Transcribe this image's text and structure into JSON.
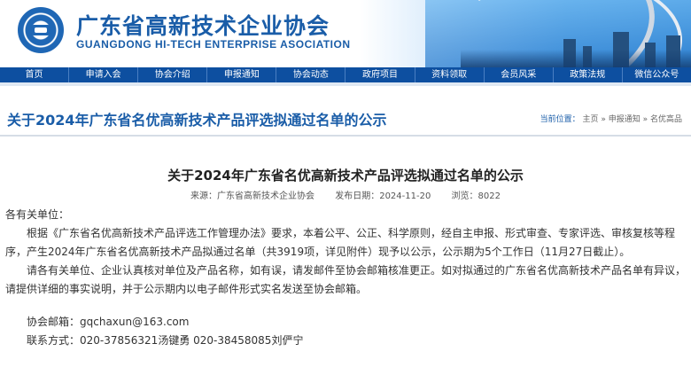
{
  "header": {
    "title": "广东省高新技术企业协会",
    "subtitle": "GUANGDONG HI-TECH ENTERPRISE ASOCIATION"
  },
  "nav": {
    "items": [
      "首页",
      "申请入会",
      "协会介绍",
      "申报通知",
      "协会动态",
      "政府项目",
      "资料领取",
      "会员风采",
      "政策法规",
      "微信公众号"
    ]
  },
  "page": {
    "heading": "关于2024年广东省名优高新技术产品评选拟通过名单的公示",
    "breadcrumb_label": "当前位置：",
    "breadcrumb": [
      "主页",
      "申报通知",
      "名优高品"
    ],
    "breadcrumb_sep": " » "
  },
  "article": {
    "title": "关于2024年广东省名优高新技术产品评选拟通过名单的公示",
    "source": "来源：广东省高新技术企业协会",
    "date": "发布日期：2024-11-20",
    "views": "浏览：8022",
    "greeting": "各有关单位：",
    "para1": "根据《广东省名优高新技术产品评选工作管理办法》要求，本着公平、公正、科学原则，经自主申报、形式审查、专家评选、审核复核等程序，产生2024年广东省名优高新技术产品拟通过名单（共3919项，详见附件）现予以公示，公示期为5个工作日（11月27日截止）。",
    "para2": "请各有关单位、企业认真核对单位及产品名称，如有误，请发邮件至协会邮箱核准更正。如对拟通过的广东省名优高新技术产品名单有异议，请提供详细的事实说明，并于公示期内以电子邮件形式实名发送至协会邮箱。",
    "email_line": "协会邮箱：gqchaxun@163.com",
    "contact_line": "联系方式：020-37856321汤键勇   020-38458085刘俨宁"
  }
}
